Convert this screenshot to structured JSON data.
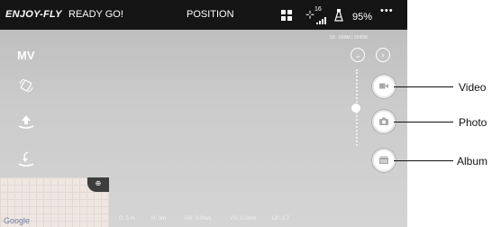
{
  "topbar": {
    "brand": "ENJOY-FLY",
    "status": "READY GO!",
    "mode": "POSITION",
    "gps_count": "16",
    "battery_percent": "95%",
    "more": "•••"
  },
  "left": {
    "mode_label": "MV"
  },
  "right": {
    "limits": "50 · 500M / 1540M"
  },
  "callouts": {
    "video": "Video",
    "photo": "Photo",
    "album": "Album"
  },
  "map": {
    "attribution": "Google"
  },
  "telemetry": {
    "d": "D: 5 m",
    "h": "H: 0m",
    "hs": "HS: 0.0m/s",
    "vs": "VS: 0.0m/s",
    "lp": "LP: 1.7"
  },
  "colors": {
    "topbar": "#151515",
    "screen": "#c4c4c4",
    "button_icon": "#a9a9a9"
  }
}
